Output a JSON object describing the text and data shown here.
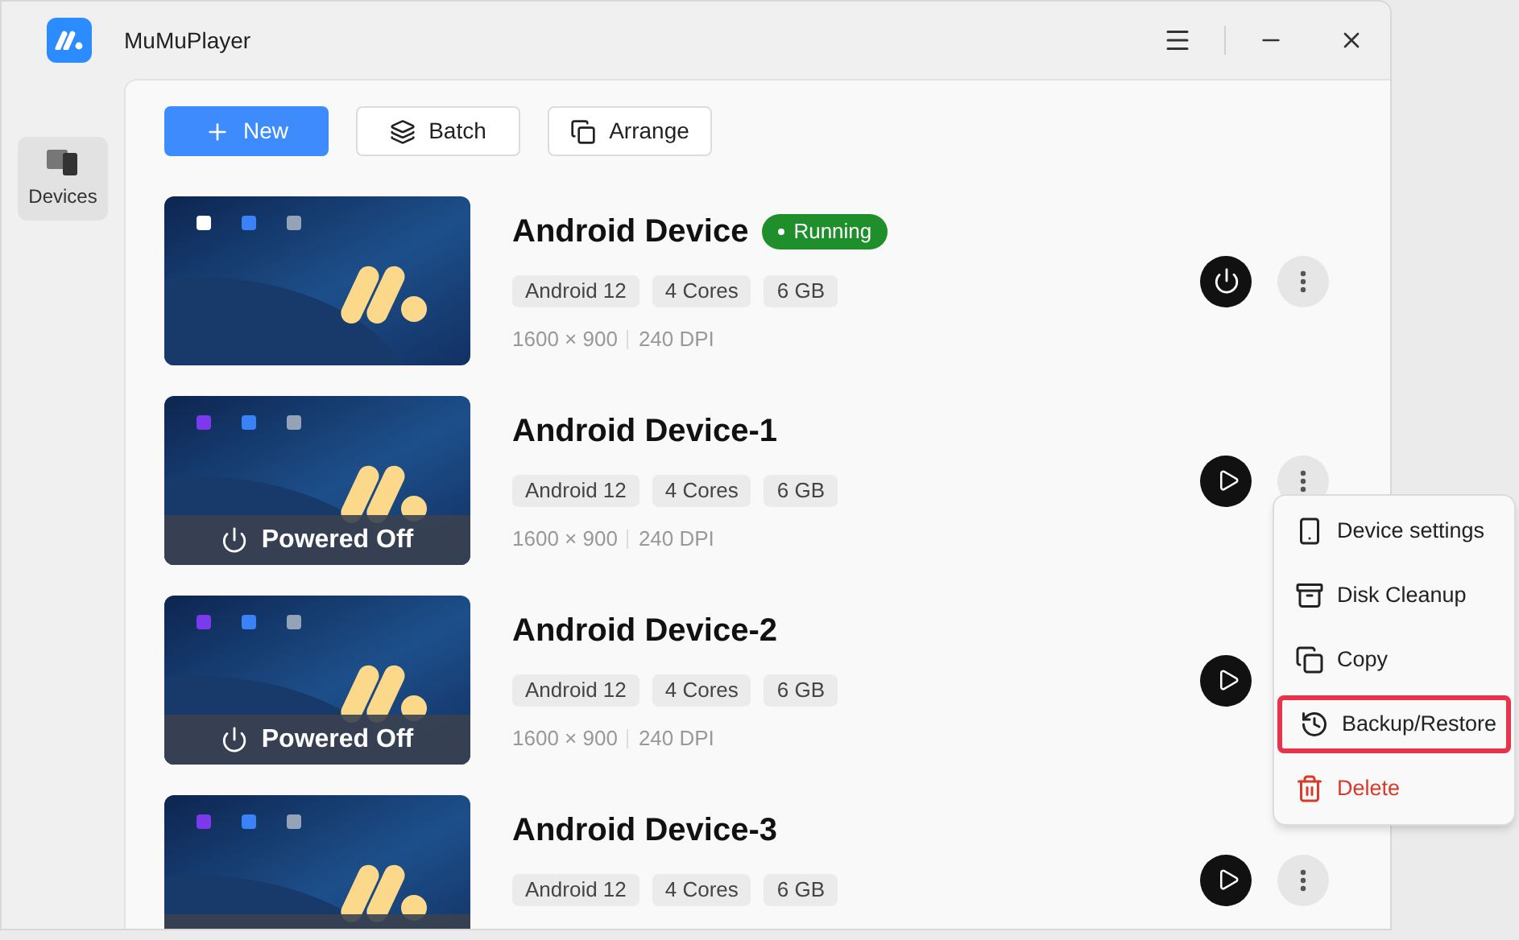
{
  "window": {
    "title": "MuMuPlayer"
  },
  "sidebar": {
    "items": [
      {
        "label": "Devices",
        "selected": true
      }
    ]
  },
  "toolbar": [
    {
      "kind": "primary",
      "label": "New"
    },
    {
      "kind": "batch",
      "label": "Batch"
    },
    {
      "kind": "arrange",
      "label": "Arrange"
    }
  ],
  "devices": [
    {
      "name": "Android Device",
      "running": true,
      "status": "Running",
      "tags": [
        "Android 12",
        "4 Cores",
        "6 GB"
      ],
      "resolution": "1600 × 900",
      "dpi": "240 DPI"
    },
    {
      "name": "Android Device-1",
      "running": false,
      "overlay": "Powered Off",
      "tags": [
        "Android 12",
        "4 Cores",
        "6 GB"
      ],
      "resolution": "1600 × 900",
      "dpi": "240 DPI"
    },
    {
      "name": "Android Device-2",
      "running": false,
      "overlay": "Powered Off",
      "tags": [
        "Android 12",
        "4 Cores",
        "6 GB"
      ],
      "resolution": "1600 × 900",
      "dpi": "240 DPI"
    },
    {
      "name": "Android Device-3",
      "running": false,
      "tags": [
        "Android 12",
        "4 Cores",
        "6 GB"
      ]
    }
  ],
  "context_menu": {
    "items": [
      {
        "kind": "settings",
        "label": "Device settings",
        "highlighted": false
      },
      {
        "kind": "cleanup",
        "label": "Disk Cleanup",
        "highlighted": false
      },
      {
        "kind": "copy",
        "label": "Copy",
        "highlighted": false
      },
      {
        "kind": "backup",
        "label": "Backup/Restore",
        "highlighted": true
      },
      {
        "kind": "delete",
        "label": "Delete",
        "highlighted": false
      }
    ]
  }
}
